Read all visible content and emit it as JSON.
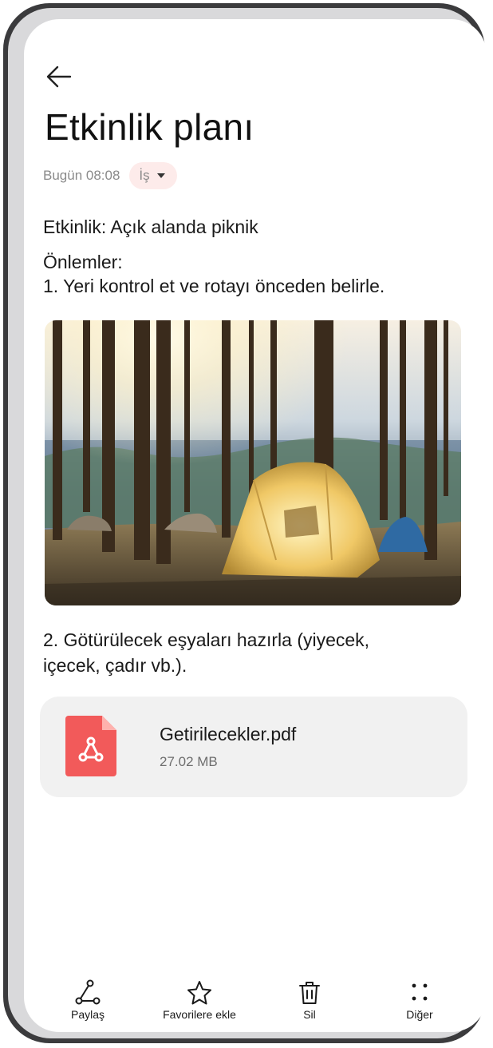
{
  "note": {
    "title": "Etkinlik planı",
    "date": "Bugün 08:08",
    "category": "İş",
    "line1": "Etkinlik: Açık alanda piknik",
    "line2": "Önlemler:",
    "line3": "1. Yeri kontrol et ve rotayı önceden belirle.",
    "line4": "2. Götürülecek eşyaları hazırla (yiyecek,",
    "line5": "içecek, çadır vb.).",
    "image_icon": "camping-tent-photo"
  },
  "attachment": {
    "name": "Getirilecekler.pdf",
    "size": "27.02 MB",
    "icon": "pdf-icon",
    "icon_color": "#f25a5a"
  },
  "toolbar": {
    "share": "Paylaş",
    "favorite": "Favorilere ekle",
    "delete": "Sil",
    "more": "Diğer"
  },
  "colors": {
    "tag_bg": "#fdebea",
    "card_bg": "#f1f1f1"
  }
}
